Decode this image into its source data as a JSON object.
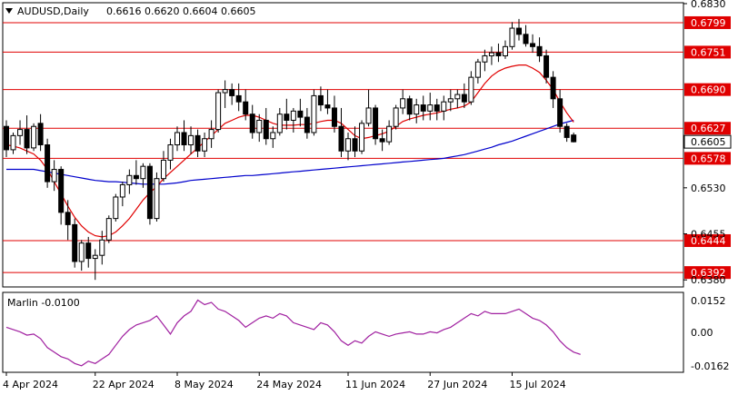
{
  "header": {
    "symbol_timeframe": "AUDUSD,Daily",
    "ohlc": "0.6616 0.6620 0.6604 0.6605"
  },
  "indicator": {
    "name_value": "Marlin -0.0100",
    "scale": [
      "0.0152",
      "0.00",
      "-0.0162"
    ]
  },
  "colors": {
    "level_line": "#e00000",
    "ma_fast": "#e00000",
    "ma_slow": "#0000cc",
    "oscillator": "#a020a0",
    "bull_body": "#ffffff",
    "bear_body": "#000000",
    "current_price_bg": "#ffffff"
  },
  "chart_data": {
    "type": "candlestick",
    "ylim": [
      0.637,
      0.683
    ],
    "y_ticks": [
      "0.6830",
      "0.6530",
      "0.6455",
      "0.6380"
    ],
    "x_tick_labels": [
      "4 Apr 2024",
      "22 Apr 2024",
      "8 May 2024",
      "24 May 2024",
      "11 Jun 2024",
      "27 Jun 2024",
      "15 Jul 2024"
    ],
    "x_tick_index": [
      0,
      13,
      25,
      37,
      50,
      62,
      74
    ],
    "levels": [
      "0.6799",
      "0.6751",
      "0.6690",
      "0.6627",
      "0.6578",
      "0.6444",
      "0.6392"
    ],
    "current_price": "0.6605",
    "candles": [
      [
        0.663,
        0.664,
        0.658,
        0.6592
      ],
      [
        0.6592,
        0.662,
        0.6585,
        0.6615
      ],
      [
        0.6615,
        0.664,
        0.66,
        0.6625
      ],
      [
        0.6625,
        0.6648,
        0.6585,
        0.6595
      ],
      [
        0.6595,
        0.6635,
        0.659,
        0.663
      ],
      [
        0.6635,
        0.665,
        0.659,
        0.66
      ],
      [
        0.66,
        0.661,
        0.653,
        0.654
      ],
      [
        0.654,
        0.6575,
        0.6525,
        0.656
      ],
      [
        0.656,
        0.6565,
        0.647,
        0.649
      ],
      [
        0.649,
        0.651,
        0.6445,
        0.647
      ],
      [
        0.647,
        0.648,
        0.64,
        0.641
      ],
      [
        0.641,
        0.6445,
        0.6395,
        0.644
      ],
      [
        0.644,
        0.645,
        0.64,
        0.6415
      ],
      [
        0.6415,
        0.643,
        0.638,
        0.642
      ],
      [
        0.642,
        0.646,
        0.6405,
        0.6445
      ],
      [
        0.6445,
        0.6485,
        0.644,
        0.648
      ],
      [
        0.648,
        0.652,
        0.6475,
        0.6515
      ],
      [
        0.6515,
        0.654,
        0.65,
        0.6535
      ],
      [
        0.6535,
        0.656,
        0.652,
        0.655
      ],
      [
        0.655,
        0.6575,
        0.6535,
        0.6545
      ],
      [
        0.6545,
        0.657,
        0.653,
        0.6565
      ],
      [
        0.6565,
        0.657,
        0.647,
        0.648
      ],
      [
        0.648,
        0.6555,
        0.6475,
        0.6545
      ],
      [
        0.6545,
        0.659,
        0.654,
        0.6575
      ],
      [
        0.6575,
        0.661,
        0.656,
        0.66
      ],
      [
        0.66,
        0.663,
        0.659,
        0.662
      ],
      [
        0.662,
        0.664,
        0.659,
        0.66
      ],
      [
        0.66,
        0.663,
        0.6585,
        0.6615
      ],
      [
        0.6615,
        0.6625,
        0.658,
        0.659
      ],
      [
        0.659,
        0.662,
        0.658,
        0.661
      ],
      [
        0.661,
        0.664,
        0.6595,
        0.6625
      ],
      [
        0.6625,
        0.669,
        0.662,
        0.6685
      ],
      [
        0.6685,
        0.6705,
        0.666,
        0.669
      ],
      [
        0.669,
        0.67,
        0.6665,
        0.668
      ],
      [
        0.668,
        0.67,
        0.6655,
        0.667
      ],
      [
        0.667,
        0.669,
        0.664,
        0.665
      ],
      [
        0.665,
        0.6665,
        0.661,
        0.662
      ],
      [
        0.662,
        0.665,
        0.6605,
        0.664
      ],
      [
        0.664,
        0.666,
        0.66,
        0.661
      ],
      [
        0.661,
        0.663,
        0.6595,
        0.662
      ],
      [
        0.662,
        0.666,
        0.6615,
        0.665
      ],
      [
        0.665,
        0.6675,
        0.6625,
        0.664
      ],
      [
        0.664,
        0.666,
        0.662,
        0.6655
      ],
      [
        0.6655,
        0.6675,
        0.663,
        0.6645
      ],
      [
        0.6645,
        0.666,
        0.661,
        0.662
      ],
      [
        0.662,
        0.669,
        0.6615,
        0.668
      ],
      [
        0.668,
        0.6695,
        0.6655,
        0.6665
      ],
      [
        0.6665,
        0.669,
        0.665,
        0.666
      ],
      [
        0.666,
        0.668,
        0.662,
        0.663
      ],
      [
        0.663,
        0.666,
        0.658,
        0.659
      ],
      [
        0.659,
        0.662,
        0.6575,
        0.661
      ],
      [
        0.661,
        0.663,
        0.658,
        0.659
      ],
      [
        0.659,
        0.664,
        0.6585,
        0.6635
      ],
      [
        0.6635,
        0.669,
        0.663,
        0.666
      ],
      [
        0.666,
        0.6665,
        0.66,
        0.661
      ],
      [
        0.661,
        0.6625,
        0.659,
        0.6605
      ],
      [
        0.6605,
        0.664,
        0.66,
        0.663
      ],
      [
        0.663,
        0.6665,
        0.6625,
        0.666
      ],
      [
        0.666,
        0.669,
        0.665,
        0.6675
      ],
      [
        0.6675,
        0.668,
        0.664,
        0.665
      ],
      [
        0.665,
        0.6675,
        0.6635,
        0.6665
      ],
      [
        0.6665,
        0.668,
        0.664,
        0.6655
      ],
      [
        0.6655,
        0.6685,
        0.664,
        0.6665
      ],
      [
        0.6665,
        0.6675,
        0.664,
        0.6655
      ],
      [
        0.6655,
        0.668,
        0.664,
        0.667
      ],
      [
        0.667,
        0.669,
        0.6655,
        0.6675
      ],
      [
        0.6675,
        0.669,
        0.666,
        0.6682
      ],
      [
        0.6682,
        0.67,
        0.666,
        0.667
      ],
      [
        0.667,
        0.672,
        0.6665,
        0.671
      ],
      [
        0.671,
        0.674,
        0.67,
        0.6735
      ],
      [
        0.6735,
        0.6755,
        0.672,
        0.6745
      ],
      [
        0.6745,
        0.676,
        0.673,
        0.675
      ],
      [
        0.675,
        0.6765,
        0.6735,
        0.6745
      ],
      [
        0.6745,
        0.677,
        0.674,
        0.676
      ],
      [
        0.676,
        0.68,
        0.6755,
        0.679
      ],
      [
        0.679,
        0.6805,
        0.677,
        0.678
      ],
      [
        0.678,
        0.6795,
        0.676,
        0.6765
      ],
      [
        0.6765,
        0.678,
        0.675,
        0.676
      ],
      [
        0.676,
        0.6775,
        0.6735,
        0.6745
      ],
      [
        0.6745,
        0.6755,
        0.67,
        0.671
      ],
      [
        0.671,
        0.672,
        0.666,
        0.6675
      ],
      [
        0.6675,
        0.669,
        0.662,
        0.663
      ],
      [
        0.663,
        0.6635,
        0.6605,
        0.6612
      ],
      [
        0.6616,
        0.662,
        0.6604,
        0.6605
      ]
    ],
    "ma_fast": [
      0.66,
      0.6598,
      0.6595,
      0.659,
      0.6585,
      0.6575,
      0.656,
      0.654,
      0.652,
      0.65,
      0.6482,
      0.6468,
      0.6458,
      0.6452,
      0.645,
      0.6452,
      0.6458,
      0.6468,
      0.648,
      0.6495,
      0.651,
      0.6522,
      0.6532,
      0.6545,
      0.6555,
      0.6565,
      0.6575,
      0.6585,
      0.6595,
      0.6605,
      0.6615,
      0.6625,
      0.6635,
      0.664,
      0.6645,
      0.6648,
      0.6648,
      0.6645,
      0.664,
      0.6635,
      0.6632,
      0.6632,
      0.6632,
      0.6633,
      0.6633,
      0.6635,
      0.6638,
      0.664,
      0.664,
      0.6635,
      0.6625,
      0.6615,
      0.661,
      0.6612,
      0.6615,
      0.6618,
      0.6622,
      0.663,
      0.6638,
      0.6642,
      0.6645,
      0.6648,
      0.665,
      0.6652,
      0.6655,
      0.6658,
      0.666,
      0.6663,
      0.667,
      0.6685,
      0.67,
      0.6712,
      0.672,
      0.6725,
      0.6728,
      0.673,
      0.673,
      0.6725,
      0.6718,
      0.6705,
      0.669,
      0.667,
      0.6652,
      0.6637
    ],
    "ma_slow": [
      0.656,
      0.656,
      0.656,
      0.656,
      0.656,
      0.6558,
      0.6556,
      0.6554,
      0.6552,
      0.655,
      0.6548,
      0.6546,
      0.6544,
      0.6542,
      0.6541,
      0.654,
      0.654,
      0.6539,
      0.6538,
      0.6537,
      0.6536,
      0.6536,
      0.6536,
      0.6536,
      0.6537,
      0.6538,
      0.654,
      0.6542,
      0.6543,
      0.6544,
      0.6545,
      0.6546,
      0.6547,
      0.6548,
      0.6549,
      0.655,
      0.655,
      0.6551,
      0.6552,
      0.6553,
      0.6554,
      0.6555,
      0.6556,
      0.6557,
      0.6558,
      0.6559,
      0.656,
      0.6561,
      0.6562,
      0.6563,
      0.6564,
      0.6565,
      0.6566,
      0.6567,
      0.6568,
      0.6569,
      0.657,
      0.6571,
      0.6572,
      0.6573,
      0.6574,
      0.6575,
      0.6576,
      0.6577,
      0.6578,
      0.658,
      0.6582,
      0.6584,
      0.6587,
      0.659,
      0.6593,
      0.6596,
      0.66,
      0.6603,
      0.6606,
      0.661,
      0.6614,
      0.6618,
      0.6622,
      0.6626,
      0.663,
      0.6634,
      0.6637,
      0.664
    ],
    "oscillator": {
      "name": "Marlin",
      "ylim": [
        -0.0175,
        0.017
      ],
      "values": [
        0.002,
        0.001,
        0.0,
        -0.0015,
        -0.001,
        -0.003,
        -0.007,
        -0.009,
        -0.011,
        -0.012,
        -0.014,
        -0.015,
        -0.013,
        -0.014,
        -0.012,
        -0.01,
        -0.006,
        -0.002,
        0.001,
        0.003,
        0.004,
        0.005,
        0.007,
        0.003,
        -0.001,
        0.004,
        0.007,
        0.009,
        0.014,
        0.012,
        0.013,
        0.01,
        0.009,
        0.007,
        0.005,
        0.002,
        0.004,
        0.006,
        0.007,
        0.006,
        0.008,
        0.007,
        0.004,
        0.003,
        0.002,
        0.001,
        0.004,
        0.003,
        0.0,
        -0.004,
        -0.006,
        -0.004,
        -0.005,
        -0.002,
        0.0,
        -0.001,
        -0.002,
        -0.001,
        -0.0005,
        0.0,
        -0.001,
        -0.001,
        0.0,
        -0.0005,
        0.001,
        0.002,
        0.004,
        0.006,
        0.008,
        0.007,
        0.009,
        0.008,
        0.008,
        0.008,
        0.009,
        0.01,
        0.008,
        0.006,
        0.005,
        0.003,
        0.0,
        -0.004,
        -0.007,
        -0.009,
        -0.01
      ]
    }
  }
}
